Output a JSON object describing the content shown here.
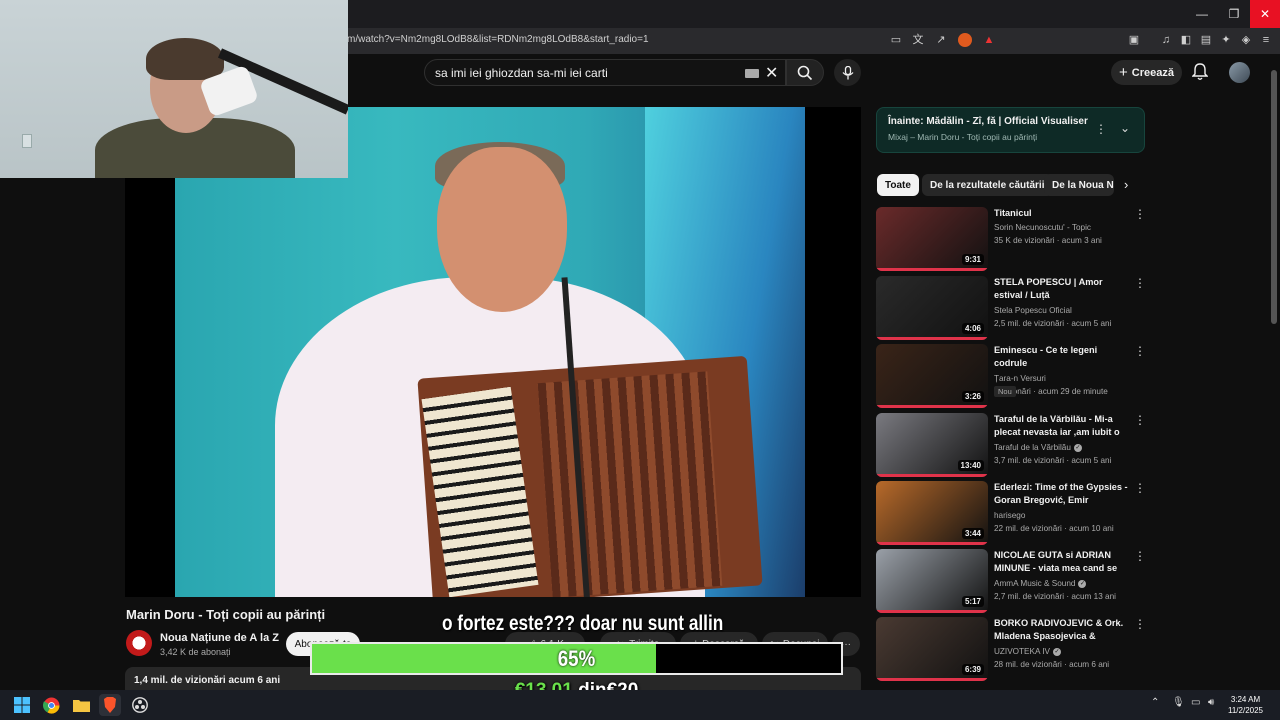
{
  "browser": {
    "url": "m/watch?v=Nm2mg8LOdB8&list=RDNm2mg8LOdB8&start_radio=1",
    "window_controls": {
      "minimize": "—",
      "restore": "❐",
      "close": "✕"
    }
  },
  "header": {
    "search_query": "sa imi iei ghiozdan sa-mi iei carti",
    "create_label": "Creează"
  },
  "video": {
    "title": "Marin Doru - Toți copii au părinți",
    "channel": "Noua Națiune de A la Z",
    "subscribers": "3,42 K de abonați",
    "subscribe_label": "Abonează-te",
    "likes": "6,1 K",
    "share_label": "Trimite",
    "download_label": "Descarcă",
    "clip_label": "Decupaj",
    "more_label": "···",
    "description_meta": "1,4 mil. de vizionări  acum 6 ani"
  },
  "overlay": {
    "caption": "o fortez este??? doar nu sunt allin",
    "goal_percent": "65%",
    "goal_fraction": 0.65,
    "goal_current": "€13.01",
    "goal_of": "din",
    "goal_target": "€20"
  },
  "up_next": {
    "title": "Înainte: Mădălin - Zî, fă | Official Visualiser",
    "subtitle": "Mixaj – Marin Doru - Toți copii au părinți"
  },
  "chips": [
    "Toate",
    "De la rezultatele căutării",
    "De la Noua Na"
  ],
  "recommendations": [
    {
      "title": "Titanicul",
      "channel": "Sorin Necunoscutu' - Topic",
      "meta": "35 K de vizionări · acum 3 ani",
      "duration": "9:31",
      "verified": false,
      "badge": "",
      "thumb_color": "#6a2a2a"
    },
    {
      "title": "STELA POPESCU | Amor estival / Luță",
      "channel": "Stela Popescu Oficial",
      "meta": "2,5 mil. de vizionări · acum 5 ani",
      "duration": "4:06",
      "verified": false,
      "badge": "",
      "thumb_color": "#2a2a2a"
    },
    {
      "title": "Eminescu - Ce te legeni codrule",
      "channel": "Țara-n Versuri",
      "meta": "3 vizionări · acum 29 de minute",
      "duration": "3:26",
      "verified": false,
      "badge": "Nou",
      "thumb_color": "#3a2418"
    },
    {
      "title": "Taraful de la Vărbilău - Mi-a plecat nevasta iar ,am iubit o ...",
      "channel": "Taraful de la Vărbilău",
      "meta": "3,7 mil. de vizionări · acum 5 ani",
      "duration": "13:40",
      "verified": true,
      "badge": "",
      "thumb_color": "#7a7a80"
    },
    {
      "title": "Ederlezi: Time of the Gypsies - Goran Bregović, Emir Kusturica",
      "channel": "harisego",
      "meta": "22 mil. de vizionări · acum 10 ani",
      "duration": "3:44",
      "verified": false,
      "badge": "",
      "thumb_color": "#b86a2a"
    },
    {
      "title": "NICOLAE GUTA si ADRIAN MINUNE - viata mea cand se v...",
      "channel": "AmmA Music & Sound",
      "meta": "2,7 mil. de vizionări · acum 13 ani",
      "duration": "5:17",
      "verified": true,
      "badge": "",
      "thumb_color": "#9aa0a8"
    },
    {
      "title": "BORKO RADIVOJEVIC & Ork. Mladena Spasojevica & Panter...",
      "channel": "UZIVOTEKA IV",
      "meta": "28 mil. de vizionări · acum 6 ani",
      "duration": "6:39",
      "verified": true,
      "badge": "",
      "thumb_color": "#4a3a32"
    }
  ],
  "taskbar": {
    "time": "3:24 AM",
    "date": "11/2/2025"
  },
  "colors": {
    "accent_green": "#6ae04b",
    "close_red": "#e81123",
    "progress_red": "#e0334a"
  }
}
